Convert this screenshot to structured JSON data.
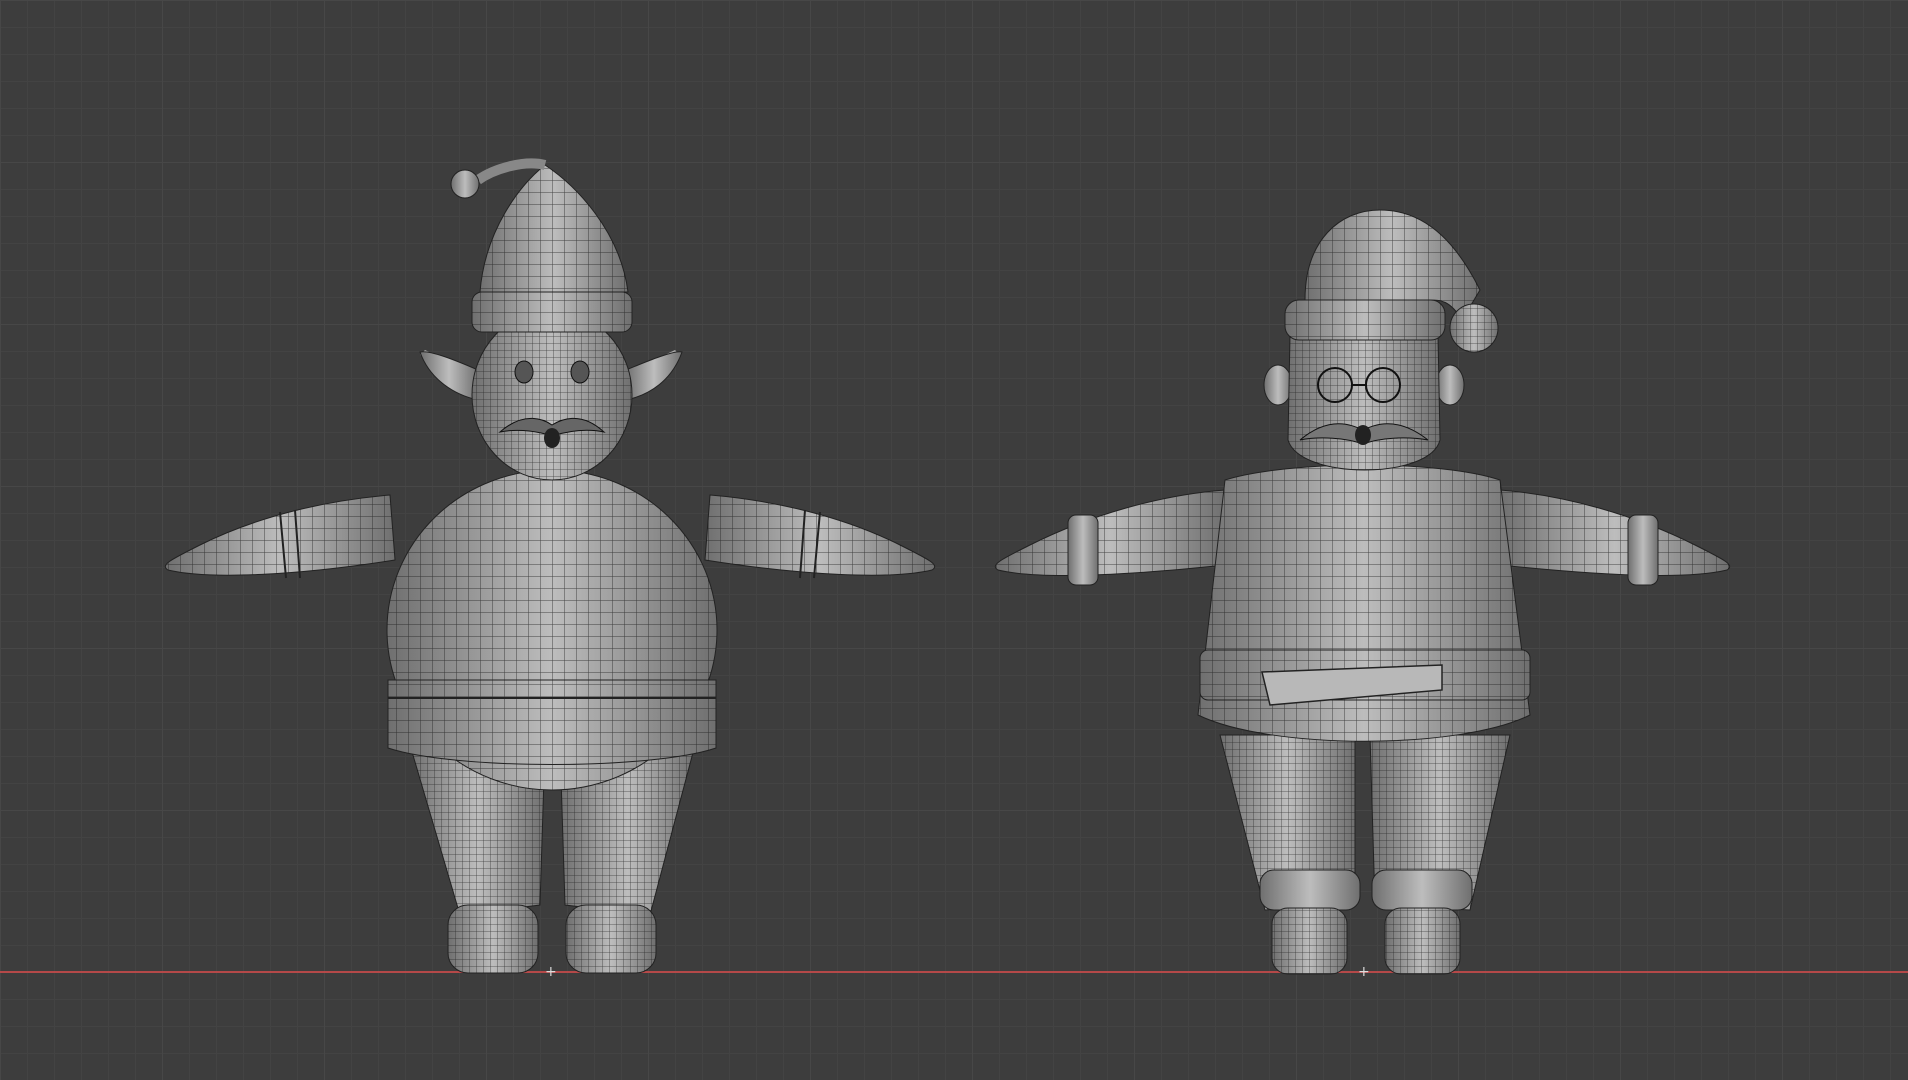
{
  "viewport": {
    "type": "3d-viewport-front-orthographic",
    "background_color": "#3d3d3d",
    "grid_color": "#474747",
    "ground_axis_color": "#c94a4a",
    "mesh_shade_color": "#9a9a9a",
    "wire_color": "#1a1a1a"
  },
  "objects": [
    {
      "name": "elf-character-mesh",
      "role": "left character, elf with pointed hat and ears"
    },
    {
      "name": "santa-character-mesh",
      "role": "right character, santa with pom-pom hat and belt"
    }
  ],
  "origin_marker_glyph": "+"
}
